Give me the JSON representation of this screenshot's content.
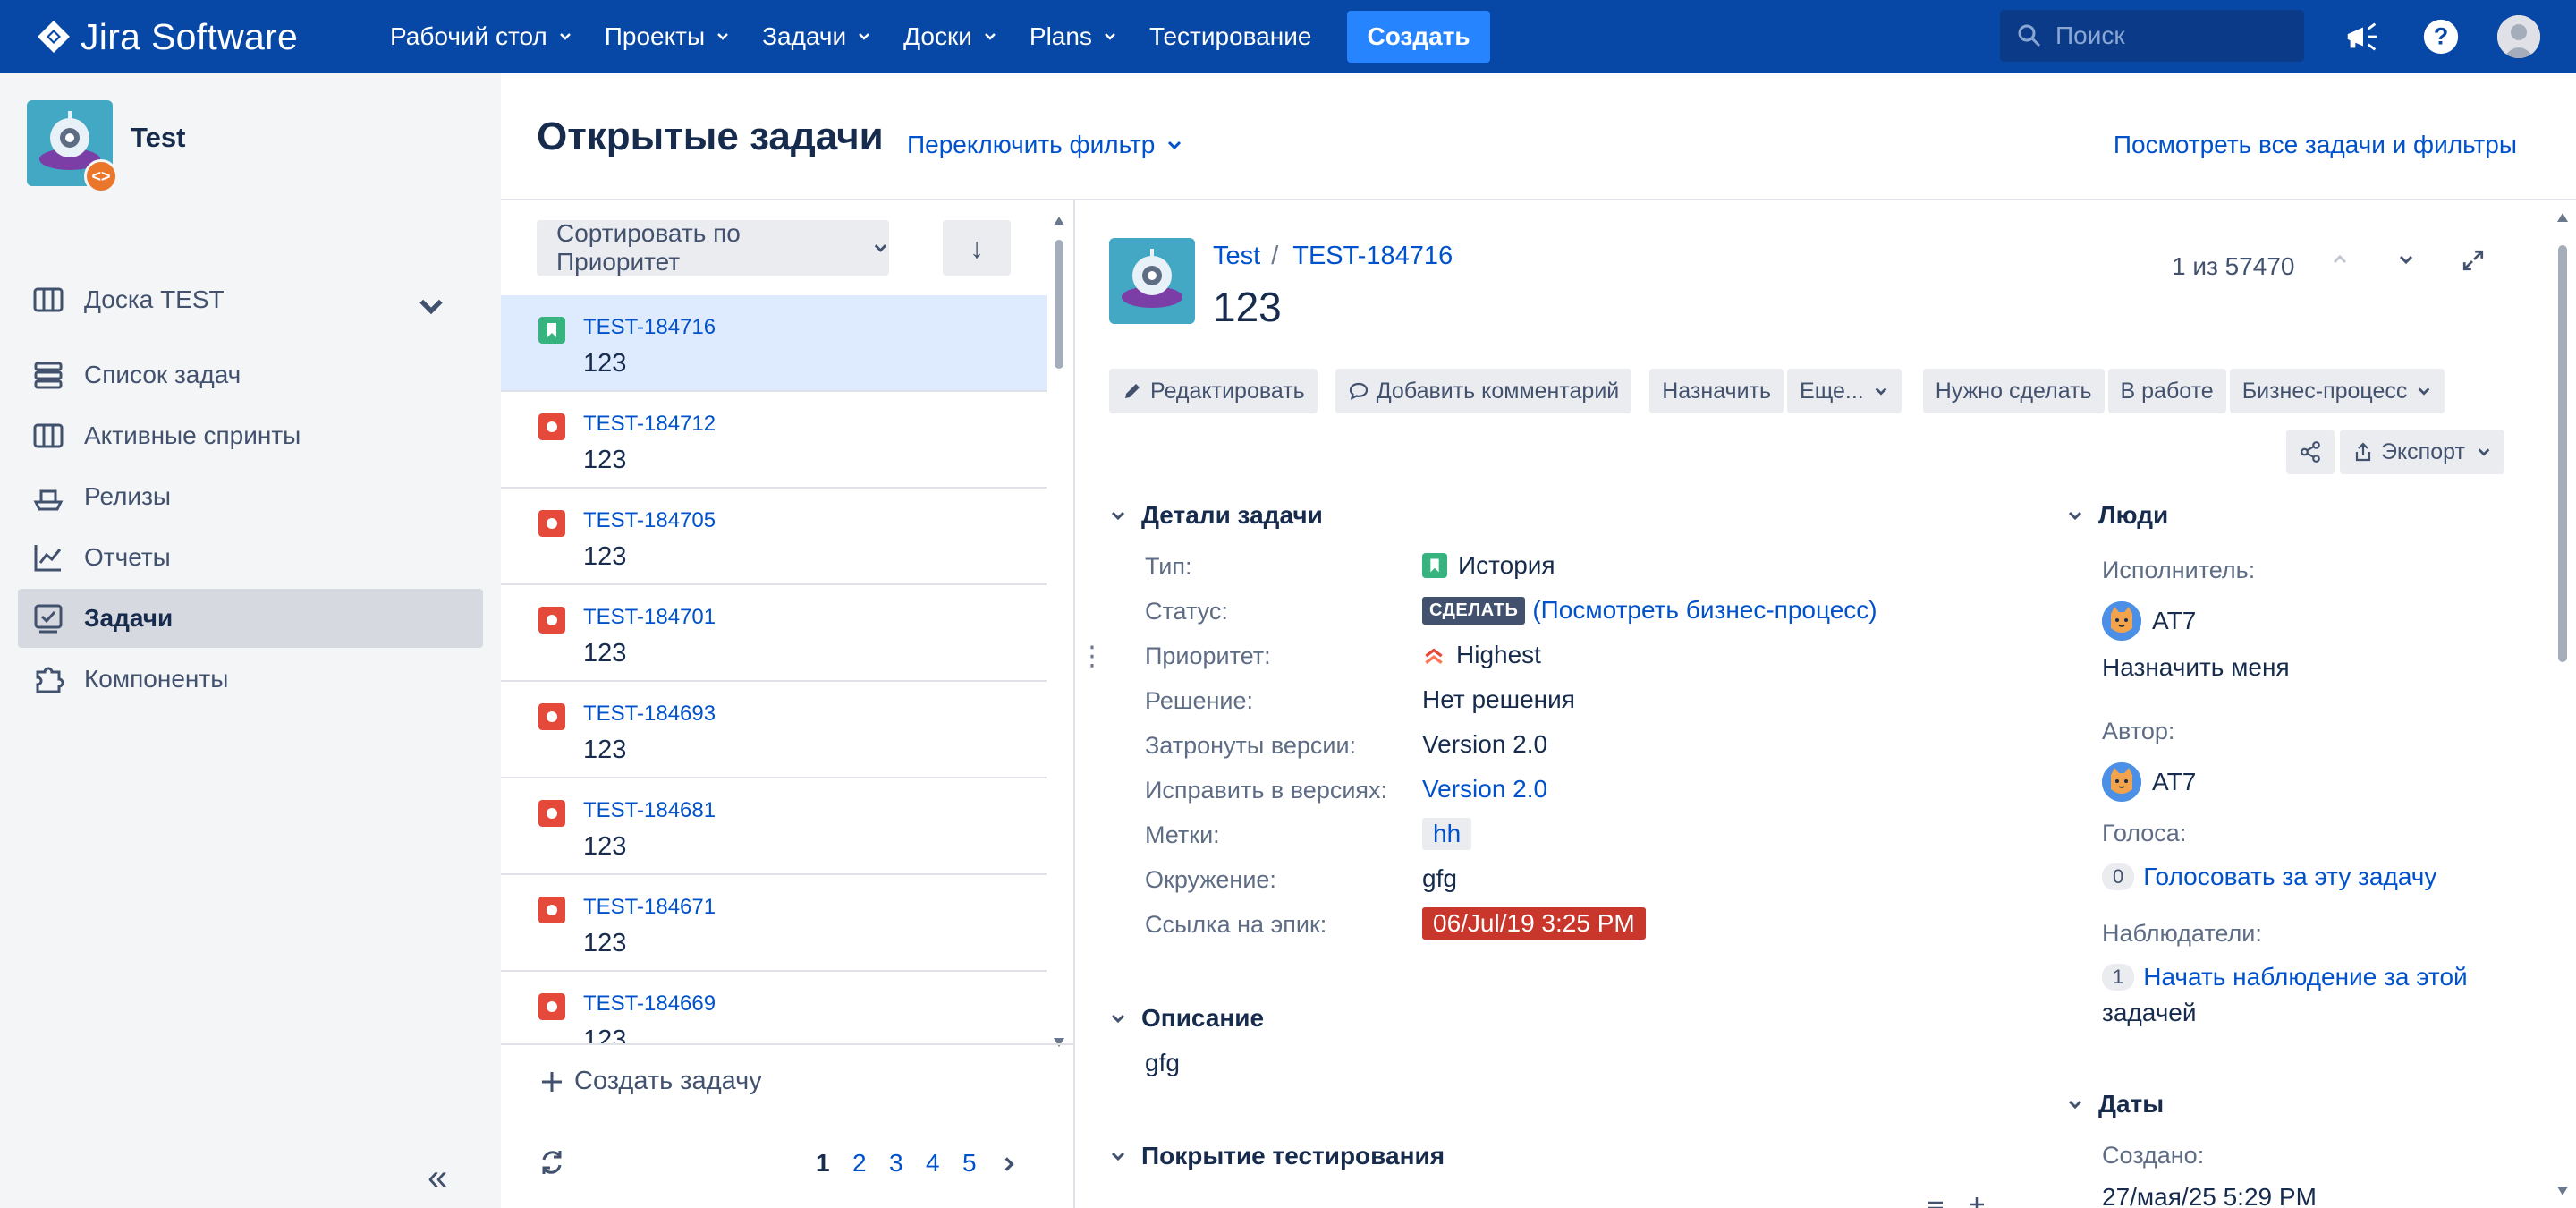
{
  "app": {
    "logo_text": "Jira Software"
  },
  "nav": {
    "items": [
      {
        "label": "Рабочий стол",
        "dropdown": true
      },
      {
        "label": "Проекты",
        "dropdown": true
      },
      {
        "label": "Задачи",
        "dropdown": true
      },
      {
        "label": "Доски",
        "dropdown": true
      },
      {
        "label": "Plans",
        "dropdown": true
      },
      {
        "label": "Тестирование",
        "dropdown": false
      }
    ],
    "create_label": "Создать",
    "search_placeholder": "Поиск"
  },
  "sidebar": {
    "project_name": "Test",
    "project_badge": "<>",
    "items": [
      {
        "label": "Доска TEST",
        "icon": "board-icon"
      },
      {
        "label": "Список задач",
        "icon": "backlog-icon"
      },
      {
        "label": "Активные спринты",
        "icon": "sprint-icon"
      },
      {
        "label": "Релизы",
        "icon": "ship-icon"
      },
      {
        "label": "Отчеты",
        "icon": "chart-icon"
      },
      {
        "label": "Задачи",
        "icon": "issues-icon",
        "active": true
      },
      {
        "label": "Компоненты",
        "icon": "puzzle-icon"
      }
    ],
    "collapse_label": "«"
  },
  "header": {
    "title": "Открытые задачи",
    "switch_filter": "Переключить фильтр",
    "view_all": "Посмотреть все задачи и фильтры"
  },
  "list": {
    "sort_label": "Сортировать по Приоритет",
    "sort_dir": "↓",
    "rows": [
      {
        "key": "TEST-184716",
        "summary": "123",
        "type": "story",
        "selected": true
      },
      {
        "key": "TEST-184712",
        "summary": "123",
        "type": "bug"
      },
      {
        "key": "TEST-184705",
        "summary": "123",
        "type": "bug"
      },
      {
        "key": "TEST-184701",
        "summary": "123",
        "type": "bug"
      },
      {
        "key": "TEST-184693",
        "summary": "123",
        "type": "bug"
      },
      {
        "key": "TEST-184681",
        "summary": "123",
        "type": "bug"
      },
      {
        "key": "TEST-184671",
        "summary": "123",
        "type": "bug"
      },
      {
        "key": "TEST-184669",
        "summary": "123",
        "type": "bug"
      }
    ],
    "create_issue": "Создать задачу",
    "pages": [
      "1",
      "2",
      "3",
      "4",
      "5"
    ],
    "current_page": "1"
  },
  "detail": {
    "breadcrumb_project": "Test",
    "breadcrumb_sep": "/",
    "breadcrumb_key": "TEST-184716",
    "title": "123",
    "position": "1 из 57470",
    "toolbar": {
      "edit": "Редактировать",
      "comment": "Добавить комментарий",
      "assign": "Назначить",
      "more": "Еще...",
      "todo": "Нужно сделать",
      "in_progress": "В работе",
      "workflow": "Бизнес-процесс",
      "export": "Экспорт"
    },
    "details_head": "Детали задачи",
    "fields": {
      "type_label": "Тип:",
      "type_value": "История",
      "status_label": "Статус:",
      "status_value": "СДЕЛАТЬ",
      "status_link": "(Посмотреть бизнес-процесс)",
      "priority_label": "Приоритет:",
      "priority_value": "Highest",
      "resolution_label": "Решение:",
      "resolution_value": "Нет решения",
      "affects_label": "Затронуты версии:",
      "affects_value": "Version 2.0",
      "fix_label": "Исправить в версиях:",
      "fix_value": "Version 2.0",
      "labels_label": "Метки:",
      "labels_value": "hh",
      "env_label": "Окружение:",
      "env_value": "gfg",
      "epic_label": "Ссылка на эпик:",
      "epic_value": "06/Jul/19 3:25 PM"
    },
    "description_head": "Описание",
    "description": "gfg",
    "coverage_head": "Покрытие тестирования",
    "people": {
      "head": "Люди",
      "assignee_label": "Исполнитель:",
      "assignee": "AT7",
      "assign_me": "Назначить меня",
      "reporter_label": "Автор:",
      "reporter": "AT7",
      "votes_label": "Голоса:",
      "votes_count": "0",
      "vote_link": "Голосовать за эту задачу",
      "watchers_label": "Наблюдатели:",
      "watchers_count": "1",
      "watch_link_1": "Начать наблюдение за этой",
      "watch_link_2": "задачей"
    },
    "dates": {
      "head": "Даты",
      "created_label": "Создано:",
      "created_value": "27/мая/25 5:29 PM"
    }
  },
  "colors": {
    "topbar": "#0747a6",
    "create": "#2684ff",
    "link": "#0052cc",
    "bug": "#e5493a",
    "story": "#36b37e",
    "epic": "#c9372c"
  }
}
